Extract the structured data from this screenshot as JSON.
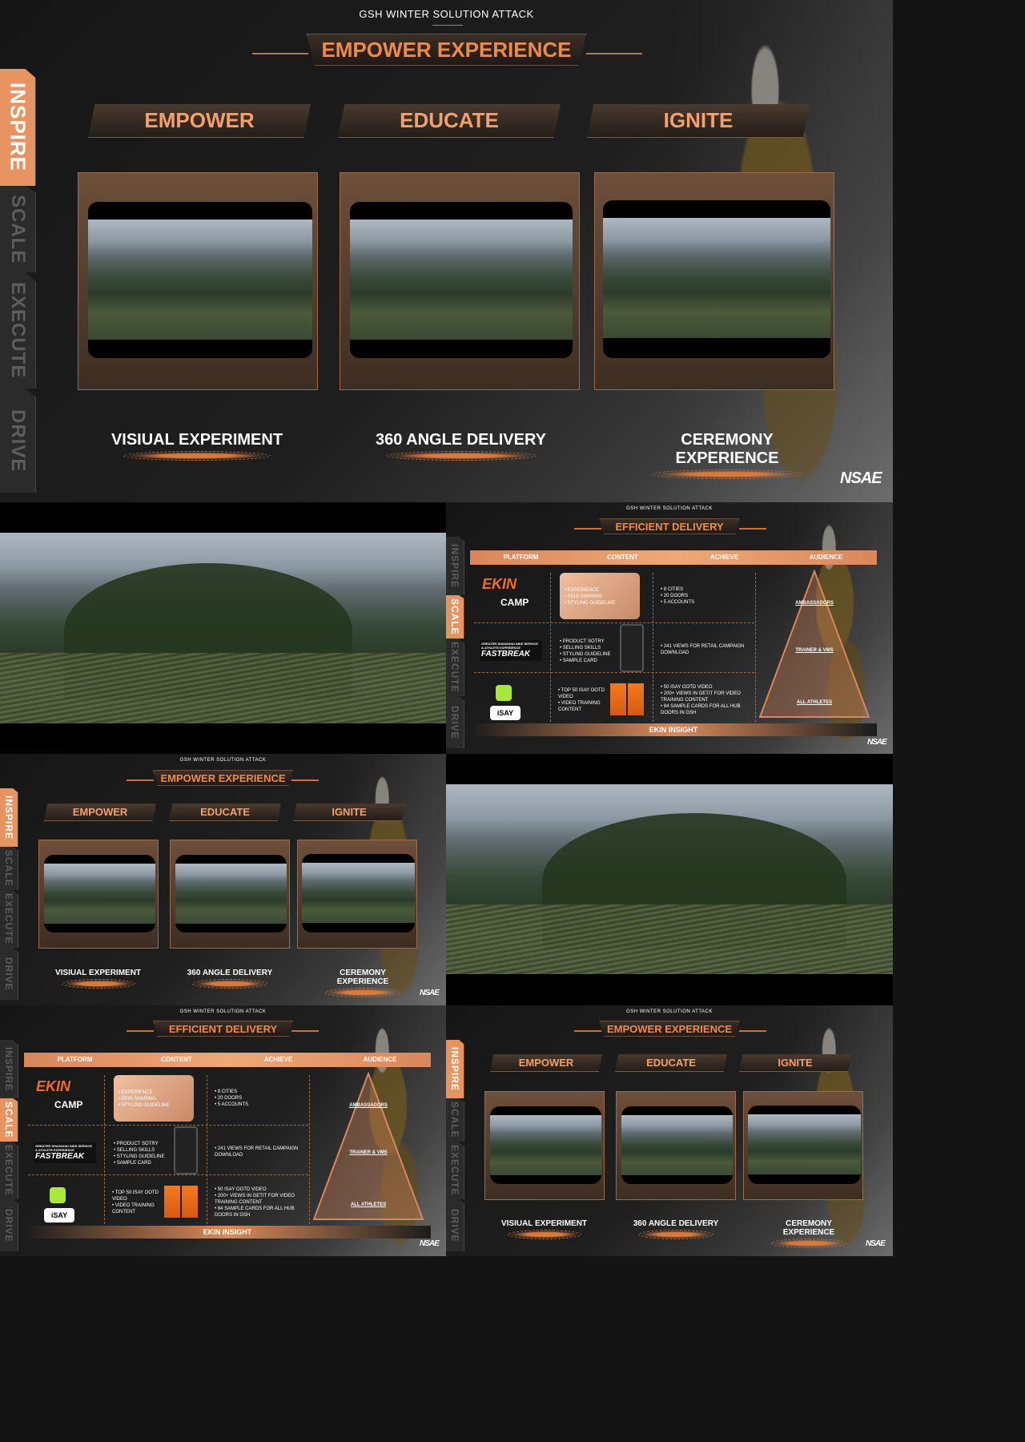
{
  "top_tag": "GSH WINTER SOLUTION ATTACK",
  "empower": {
    "title": "EMPOWER EXPERIENCE",
    "columns": [
      "EMPOWER",
      "EDUCATE",
      "IGNITE"
    ],
    "captions": [
      "VISIUAL EXPERIMENT",
      "360 ANGLE DELIVERY",
      "CEREMONY EXPERIENCE"
    ]
  },
  "side_tabs": [
    "INSPIRE",
    "SCALE",
    "EXECUTE",
    "DRIVE"
  ],
  "logo": "NSAE",
  "delivery": {
    "title": "EFFICIENT DELIVERY",
    "headers": [
      "PLATFORM",
      "CONTENT",
      "ACHIEVE",
      "AUDIENCE"
    ],
    "ekin": "EKIN",
    "camp": "CAMP",
    "fastbreak_top": "GREATER SHANGHAI NIKE SERVICE & ATHLETE EXPERIENCE",
    "fastbreak": "FASTBREAK",
    "isay": "iSAY",
    "content": [
      [
        "EXPERIENCE",
        "EKIN SHARING",
        "STYLING GUIDELINE"
      ],
      [
        "PRODUCT SOTRY",
        "SELLING SKILLS",
        "STYLING GUIDELINE",
        "SAMPLE CARD"
      ],
      [
        "TOP 50 ISAY OOTD VIDEO",
        "VIDEO TRAINING CONTENT"
      ]
    ],
    "achieve": [
      [
        "8 CITIES",
        "20 DOORS",
        "5 ACCOUNTS"
      ],
      [
        "241 VIEWS FOR RETAIL CAMPAIGN DOWNLOAD"
      ],
      [
        "50 ISAY OOTD VIDEO",
        "200+ VIEWS IN GETIT FOR VIDEO TRAINING CONTENT",
        "84 SAMPLE CARDS FOR ALL HUB DOORS IN GSH"
      ]
    ],
    "audience": [
      "AMBASSADORS",
      "TRAINER & VMS",
      "ALL ATHLETES"
    ],
    "insight": "EKIN INSIGHT"
  },
  "colors": {
    "accent": "#f08a4b",
    "tab_active": "#e79462",
    "ekin": "#f26b2a"
  }
}
